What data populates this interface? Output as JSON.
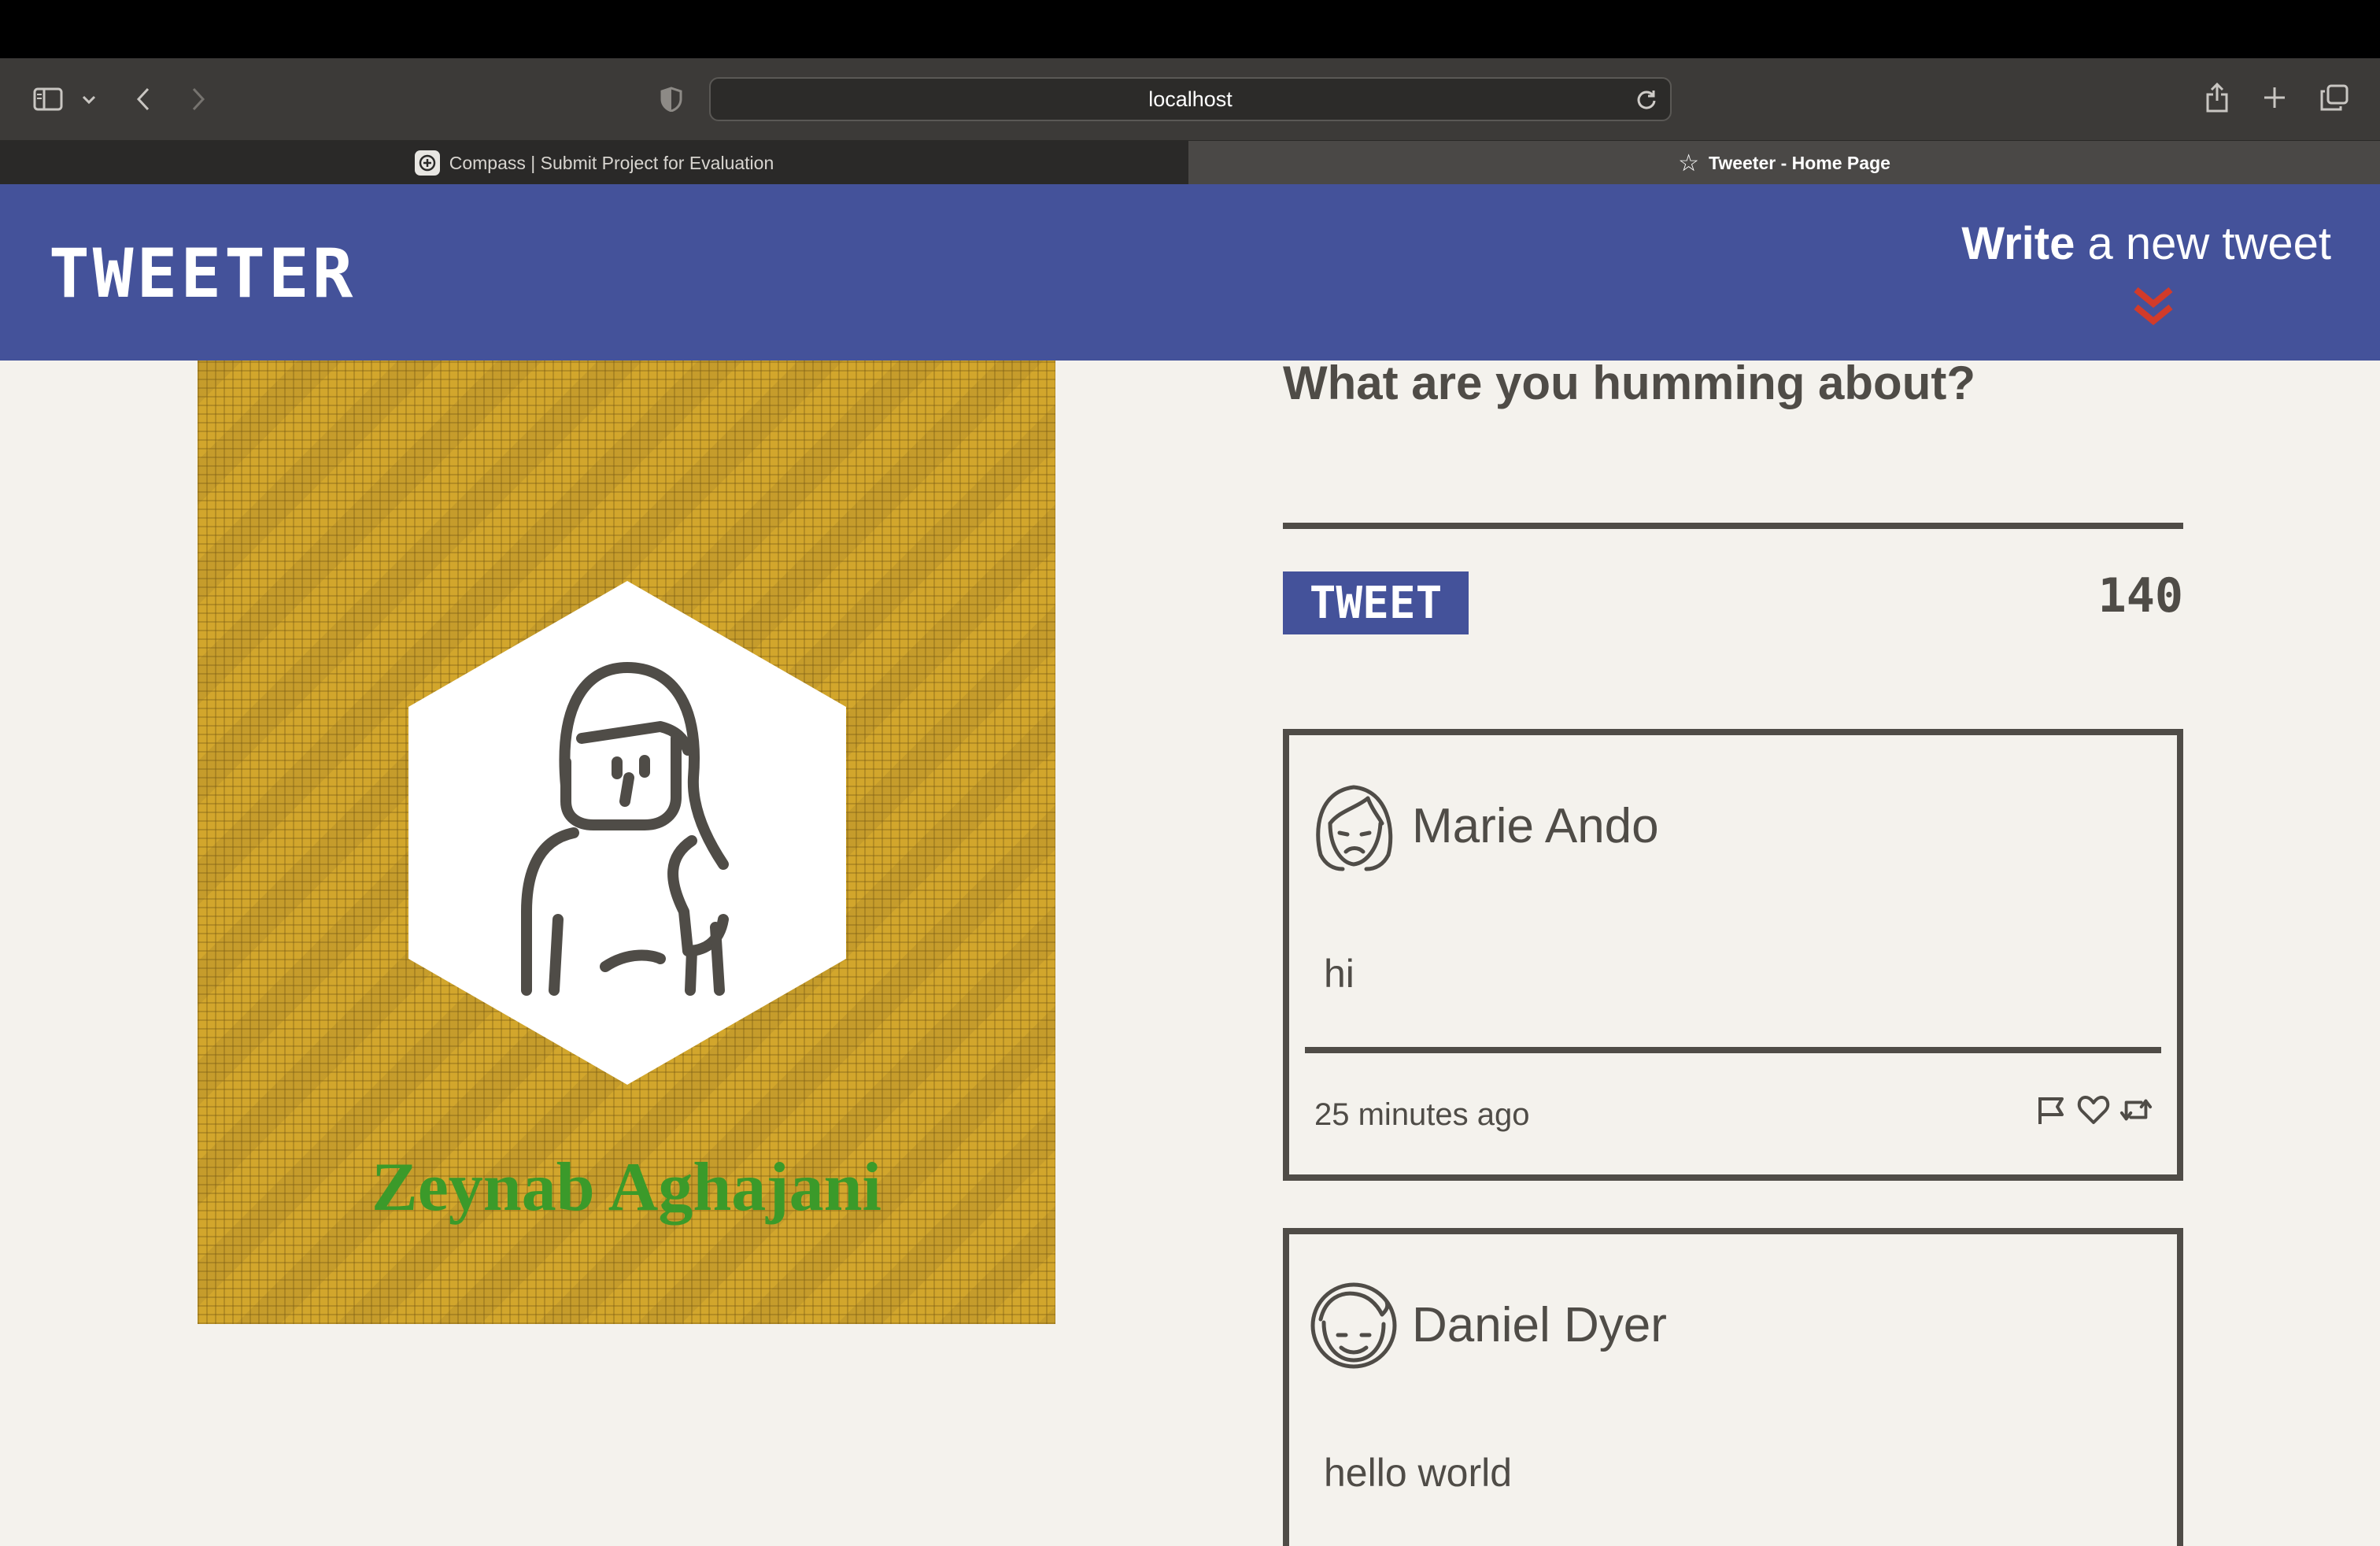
{
  "browser": {
    "url": "localhost",
    "tabs": [
      {
        "label": "Compass | Submit Project for Evaluation",
        "active": false
      },
      {
        "label": "Tweeter - Home Page",
        "active": true
      }
    ]
  },
  "header": {
    "brand": "TWEETER",
    "compose_bold": "Write",
    "compose_rest": " a new tweet",
    "accent_color": "#d23b2a",
    "bar_color": "#44529a"
  },
  "profile": {
    "name": "Zeynab Aghajani",
    "name_color": "#3b9a2a"
  },
  "composer": {
    "prompt": "What are you humming about?",
    "button_label": "TWEET",
    "counter": "140"
  },
  "tweets": [
    {
      "author": "Marie Ando",
      "content": "hi",
      "time": "25 minutes ago",
      "avatar": "girl-avatar-icon"
    },
    {
      "author": "Daniel Dyer",
      "content": "hello world",
      "avatar": "boy-avatar-icon"
    }
  ]
}
